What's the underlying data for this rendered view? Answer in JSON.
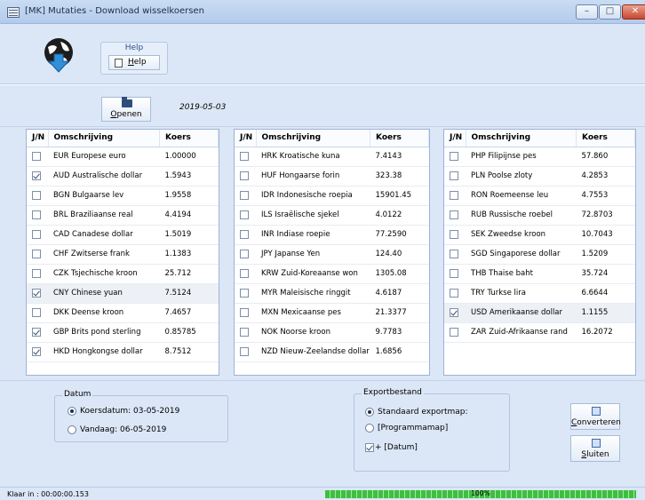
{
  "window": {
    "title": "[MK]  Mutaties - Download wisselkoersen",
    "minimize": "–",
    "maximize": "□",
    "close": "✕"
  },
  "ribbon": {
    "help_group_title": "Help",
    "help_button": "Help"
  },
  "toolbar": {
    "open_button": "Openen",
    "date": "2019-05-03"
  },
  "grid_headers": {
    "jn": "J/N",
    "desc": "Omschrijving",
    "rate": "Koers"
  },
  "grids": [
    {
      "rows": [
        {
          "checked": false,
          "desc": "EUR Europese euro",
          "rate": "1.00000"
        },
        {
          "checked": true,
          "desc": "AUD Australische dollar",
          "rate": "1.5943"
        },
        {
          "checked": false,
          "desc": "BGN Bulgaarse lev",
          "rate": "1.9558"
        },
        {
          "checked": false,
          "desc": "BRL Braziliaanse real",
          "rate": "4.4194"
        },
        {
          "checked": false,
          "desc": "CAD Canadese dollar",
          "rate": "1.5019"
        },
        {
          "checked": false,
          "desc": "CHF Zwitserse frank",
          "rate": "1.1383"
        },
        {
          "checked": false,
          "desc": "CZK Tsjechische kroon",
          "rate": "25.712"
        },
        {
          "checked": true,
          "desc": "CNY Chinese yuan",
          "rate": "7.5124",
          "selected": true
        },
        {
          "checked": false,
          "desc": "DKK Deense kroon",
          "rate": "7.4657"
        },
        {
          "checked": true,
          "desc": "GBP Brits pond sterling",
          "rate": "0.85785"
        },
        {
          "checked": true,
          "desc": "HKD Hongkongse dollar",
          "rate": "8.7512"
        }
      ]
    },
    {
      "rows": [
        {
          "checked": false,
          "desc": "HRK Kroatische kuna",
          "rate": "7.4143"
        },
        {
          "checked": false,
          "desc": "HUF Hongaarse forin",
          "rate": "323.38"
        },
        {
          "checked": false,
          "desc": "IDR Indonesische roepia",
          "rate": "15901.45"
        },
        {
          "checked": false,
          "desc": "ILS Israëlische sjekel",
          "rate": "4.0122"
        },
        {
          "checked": false,
          "desc": "INR Indiase roepie",
          "rate": "77.2590"
        },
        {
          "checked": false,
          "desc": "JPY Japanse Yen",
          "rate": "124.40"
        },
        {
          "checked": false,
          "desc": "KRW Zuid-Koreaanse won",
          "rate": "1305.08"
        },
        {
          "checked": false,
          "desc": "MYR Maleisische ringgit",
          "rate": "4.6187"
        },
        {
          "checked": false,
          "desc": "MXN Mexicaanse pes",
          "rate": "21.3377"
        },
        {
          "checked": false,
          "desc": "NOK Noorse kroon",
          "rate": "9.7783"
        },
        {
          "checked": false,
          "desc": "NZD Nieuw-Zeelandse dollar",
          "rate": "1.6856"
        }
      ]
    },
    {
      "rows": [
        {
          "checked": false,
          "desc": "PHP Filipijnse pes",
          "rate": "57.860"
        },
        {
          "checked": false,
          "desc": "PLN Poolse zloty",
          "rate": "4.2853"
        },
        {
          "checked": false,
          "desc": "RON Roemeense leu",
          "rate": "4.7553"
        },
        {
          "checked": false,
          "desc": "RUB Russische roebel",
          "rate": "72.8703"
        },
        {
          "checked": false,
          "desc": "SEK Zweedse kroon",
          "rate": "10.7043"
        },
        {
          "checked": false,
          "desc": "SGD Singaporese dollar",
          "rate": "1.5209"
        },
        {
          "checked": false,
          "desc": "THB Thaise baht",
          "rate": "35.724"
        },
        {
          "checked": false,
          "desc": "TRY Turkse lira",
          "rate": "6.6644"
        },
        {
          "checked": true,
          "desc": "USD Amerikaanse dollar",
          "rate": "1.1155",
          "selected": true
        },
        {
          "checked": false,
          "desc": "ZAR Zuid-Afrikaanse rand",
          "rate": "16.2072"
        }
      ]
    }
  ],
  "datum": {
    "title": "Datum",
    "koersdatum": "Koersdatum: 03-05-2019",
    "vandaag": "Vandaag: 06-05-2019"
  },
  "export": {
    "title": "Exportbestand",
    "standaard": "Standaard exportmap:",
    "programma": "[Programmamap]",
    "datum_check": "+ [Datum]"
  },
  "buttons": {
    "converteren": "Converteren",
    "sluiten": "Sluiten"
  },
  "status": {
    "text": "Klaar in :    00:00:00.153",
    "progress_pct": "100%",
    "progress_value": 1.0
  }
}
